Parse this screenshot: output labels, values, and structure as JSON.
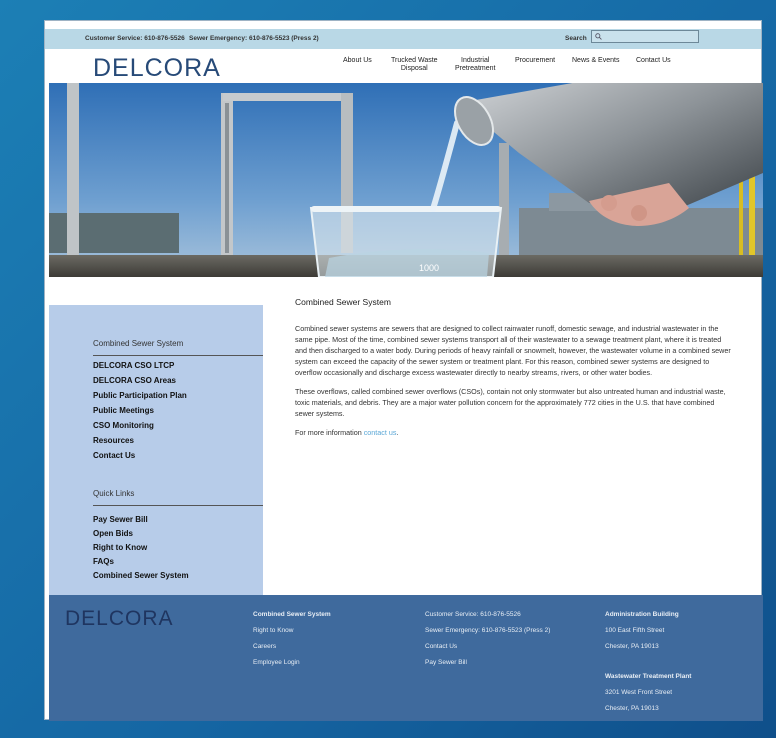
{
  "topbar": {
    "customer_service": "Customer Service: 610-876-5526",
    "sewer_emergency": "Sewer Emergency: 610-876-5523 (Press 2)",
    "search_label": "Search"
  },
  "logo": "DELCORA",
  "nav": {
    "about": "About Us",
    "trucked_line1": "Trucked Waste",
    "trucked_line2": "Disposal",
    "industrial_line1": "Industrial",
    "industrial_line2": "Pretreatment",
    "procurement": "Procurement",
    "news": "News & Events",
    "contact": "Contact Us"
  },
  "hero": {
    "beaker_mark": "1000"
  },
  "sidebar": {
    "section_heading": "Combined Sewer System",
    "links": [
      "DELCORA CSO LTCP",
      "DELCORA CSO Areas",
      "Public Participation Plan",
      "Public Meetings",
      "CSO Monitoring",
      "Resources",
      "Contact Us"
    ],
    "quick_heading": "Quick Links",
    "quick_links": [
      "Pay Sewer Bill",
      "Open Bids",
      "Right to Know",
      "FAQs",
      "Combined Sewer System"
    ]
  },
  "content": {
    "title": "Combined Sewer System",
    "p1": "Combined sewer systems are sewers that are designed to collect rainwater runoff, domestic sewage, and industrial wastewater in the same pipe. Most of the time, combined sewer systems transport all of their wastewater to a sewage treatment plant, where it is treated and then discharged to a water body. During periods of heavy rainfall or snowmelt, however, the wastewater volume in a combined sewer system can exceed the capacity of the sewer system or treatment plant. For this reason, combined sewer systems are designed to overflow occasionally and discharge excess wastewater directly to nearby streams, rivers, or other water bodies.",
    "p2": "These overflows, called combined sewer overflows (CSOs), contain not only stormwater but also untreated human and industrial waste, toxic materials, and debris. They are a major water pollution concern for the approximately 772 cities in the U.S. that have combined sewer systems.",
    "p3_prefix": "For more information ",
    "p3_link": "contact us",
    "p3_suffix": "."
  },
  "footer": {
    "logo": "DELCORA",
    "col1": [
      "Combined Sewer System",
      "Right to Know",
      "Careers",
      "Employee Login"
    ],
    "col2": [
      "Customer Service: 610-876-5526",
      "Sewer Emergency: 610-876-5523 (Press 2)",
      "Contact Us",
      "Pay Sewer Bill"
    ],
    "admin_heading": "Administration Building",
    "admin_lines": [
      "100 East Fifth Street",
      "Chester, PA 19013"
    ],
    "plant_heading": "Wastewater Treatment Plant",
    "plant_lines": [
      "3201 West Front Street",
      "Chester, PA 19013"
    ]
  }
}
